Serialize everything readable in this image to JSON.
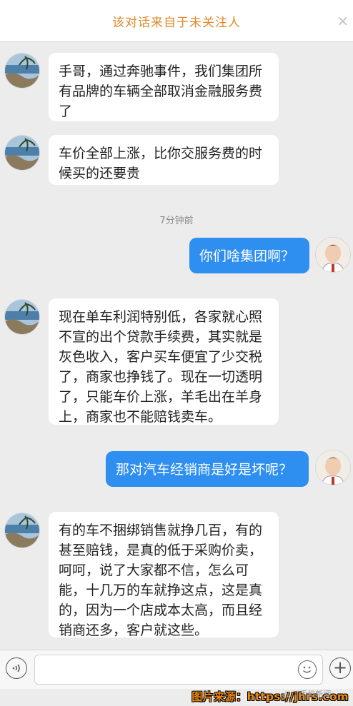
{
  "notice": {
    "text": "该对话来自于未关注人",
    "close_icon": "✕"
  },
  "messages": [
    {
      "side": "left",
      "text": "手哥，通过奔驰事件，我们集团所有品牌的车辆全部取消金融服务费了"
    },
    {
      "side": "left",
      "text": "车价全部上涨，比你交服务费的时候买的还要贵"
    },
    {
      "side": "right",
      "text": "你们啥集团啊？"
    },
    {
      "side": "left",
      "text": "现在单车利润特别低，各家就心照不宣的出个贷款手续费，其实就是灰色收入，客户买车便宜了少交税了，商家也挣钱了。现在一切透明了，只能车价上涨，羊毛出在羊身上，商家也不能赔钱卖车。"
    },
    {
      "side": "right",
      "text": "那对汽车经销商是好是坏呢？"
    },
    {
      "side": "left",
      "text": "有的车不捆绑销售就挣几百，有的甚至赔钱，是真的低于采购价卖，呵呵，说了大家都不信，怎么可能，十几万的车就挣这点，这是真的，因为一个店成本太高，而且经销商还多，客户就这些。"
    }
  ],
  "timestamp": "7分钟前",
  "footer": {
    "source": "图片来源：https://jhrs.com",
    "watermark": "⚠… 手机新闻"
  },
  "colors": {
    "accent": "#2e8ff0",
    "notice": "#e08a2b",
    "source": "#f08c14"
  }
}
